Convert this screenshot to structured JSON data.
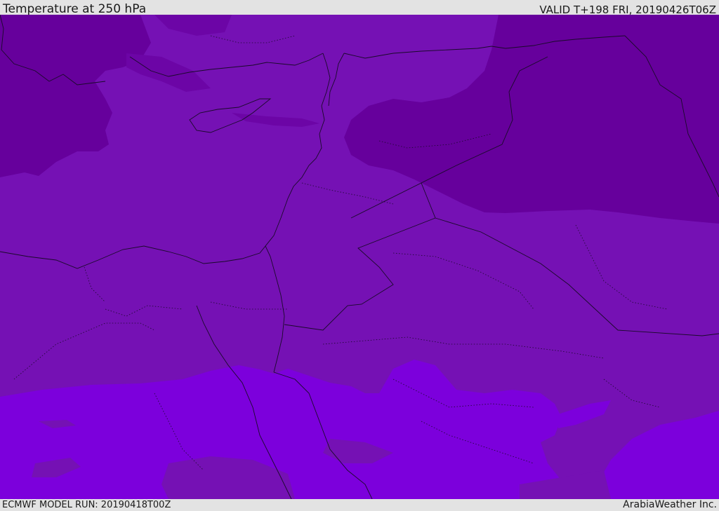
{
  "header": {
    "title": "Temperature at 250 hPa",
    "valid": "VALID T+198 FRI, 20190426T06Z"
  },
  "footer": {
    "model_run": "ECMWF MODEL RUN: 20190418T00Z",
    "credit": "ArabiaWeather Inc."
  },
  "palette": {
    "cold_dark": "#66009c",
    "mid": "#7511b4",
    "warm": "#7c00dc",
    "border": "#1a0a2a"
  }
}
